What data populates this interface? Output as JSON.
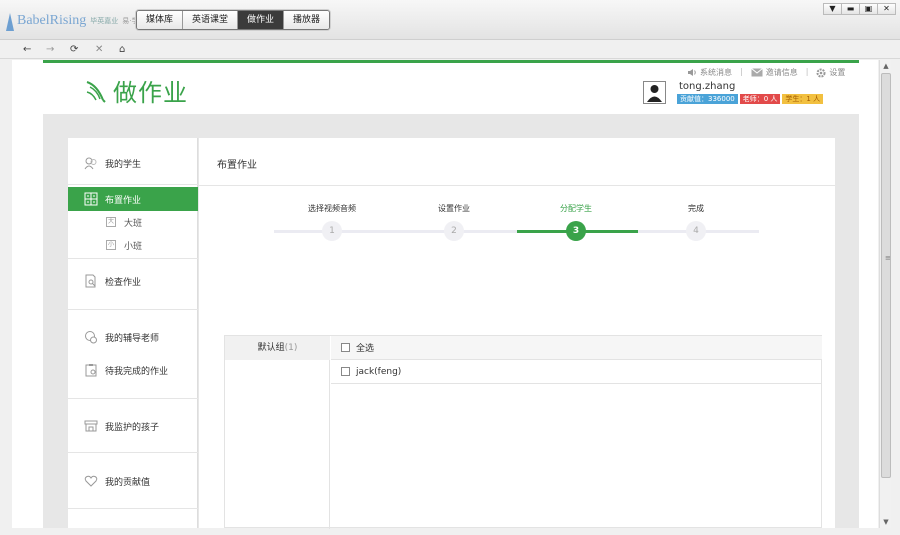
{
  "app": {
    "logo_text": "BabelRising",
    "logo_sub": "毕英嘉业",
    "logo_sub2": "易·学"
  },
  "nav_tabs": [
    {
      "label": "媒体库",
      "active": false
    },
    {
      "label": "英语课堂",
      "active": false
    },
    {
      "label": "做作业",
      "active": true
    },
    {
      "label": "播放器",
      "active": false
    }
  ],
  "window_controls": {
    "menu": "▼",
    "minimize": "▬",
    "maximize": "▣",
    "close": "✕"
  },
  "toolbar": {
    "back": "←",
    "forward": "→",
    "refresh": "⟳",
    "stop": "✕",
    "home": "⌂"
  },
  "header": {
    "page_title": "做作业",
    "links": {
      "messages": "系统消息",
      "invites": "邀请信息",
      "settings": "设置"
    },
    "user": {
      "name": "tong.zhang",
      "contribution": "贡献值：336000",
      "teachers": "老师：0 人",
      "students": "学生：1 人"
    }
  },
  "sidebar": {
    "my_students": "我的学生",
    "assign_homework": "布置作业",
    "sub_big_class": "大班",
    "sub_small_class": "小班",
    "check_homework": "检查作业",
    "my_tutors": "我的辅导老师",
    "my_pending": "待我完成的作业",
    "my_children": "我监护的孩子",
    "my_contribution": "我的贡献值",
    "sub_icon_big": "大",
    "sub_icon_small": "小"
  },
  "main": {
    "title": "布置作业",
    "steps": [
      {
        "label": "选择视频音频",
        "num": "1",
        "active": false
      },
      {
        "label": "设置作业",
        "num": "2",
        "active": false
      },
      {
        "label": "分配学生",
        "num": "3",
        "active": true
      },
      {
        "label": "完成",
        "num": "4",
        "active": false
      }
    ],
    "group": {
      "name": "默认组",
      "count": "(1)"
    },
    "select_all": "全选",
    "students": [
      "jack(feng)"
    ]
  },
  "colors": {
    "accent": "#3aa34a",
    "blue_badge": "#4aa3d8",
    "red_badge": "#e24a4a",
    "yellow_badge": "#f2c040"
  }
}
